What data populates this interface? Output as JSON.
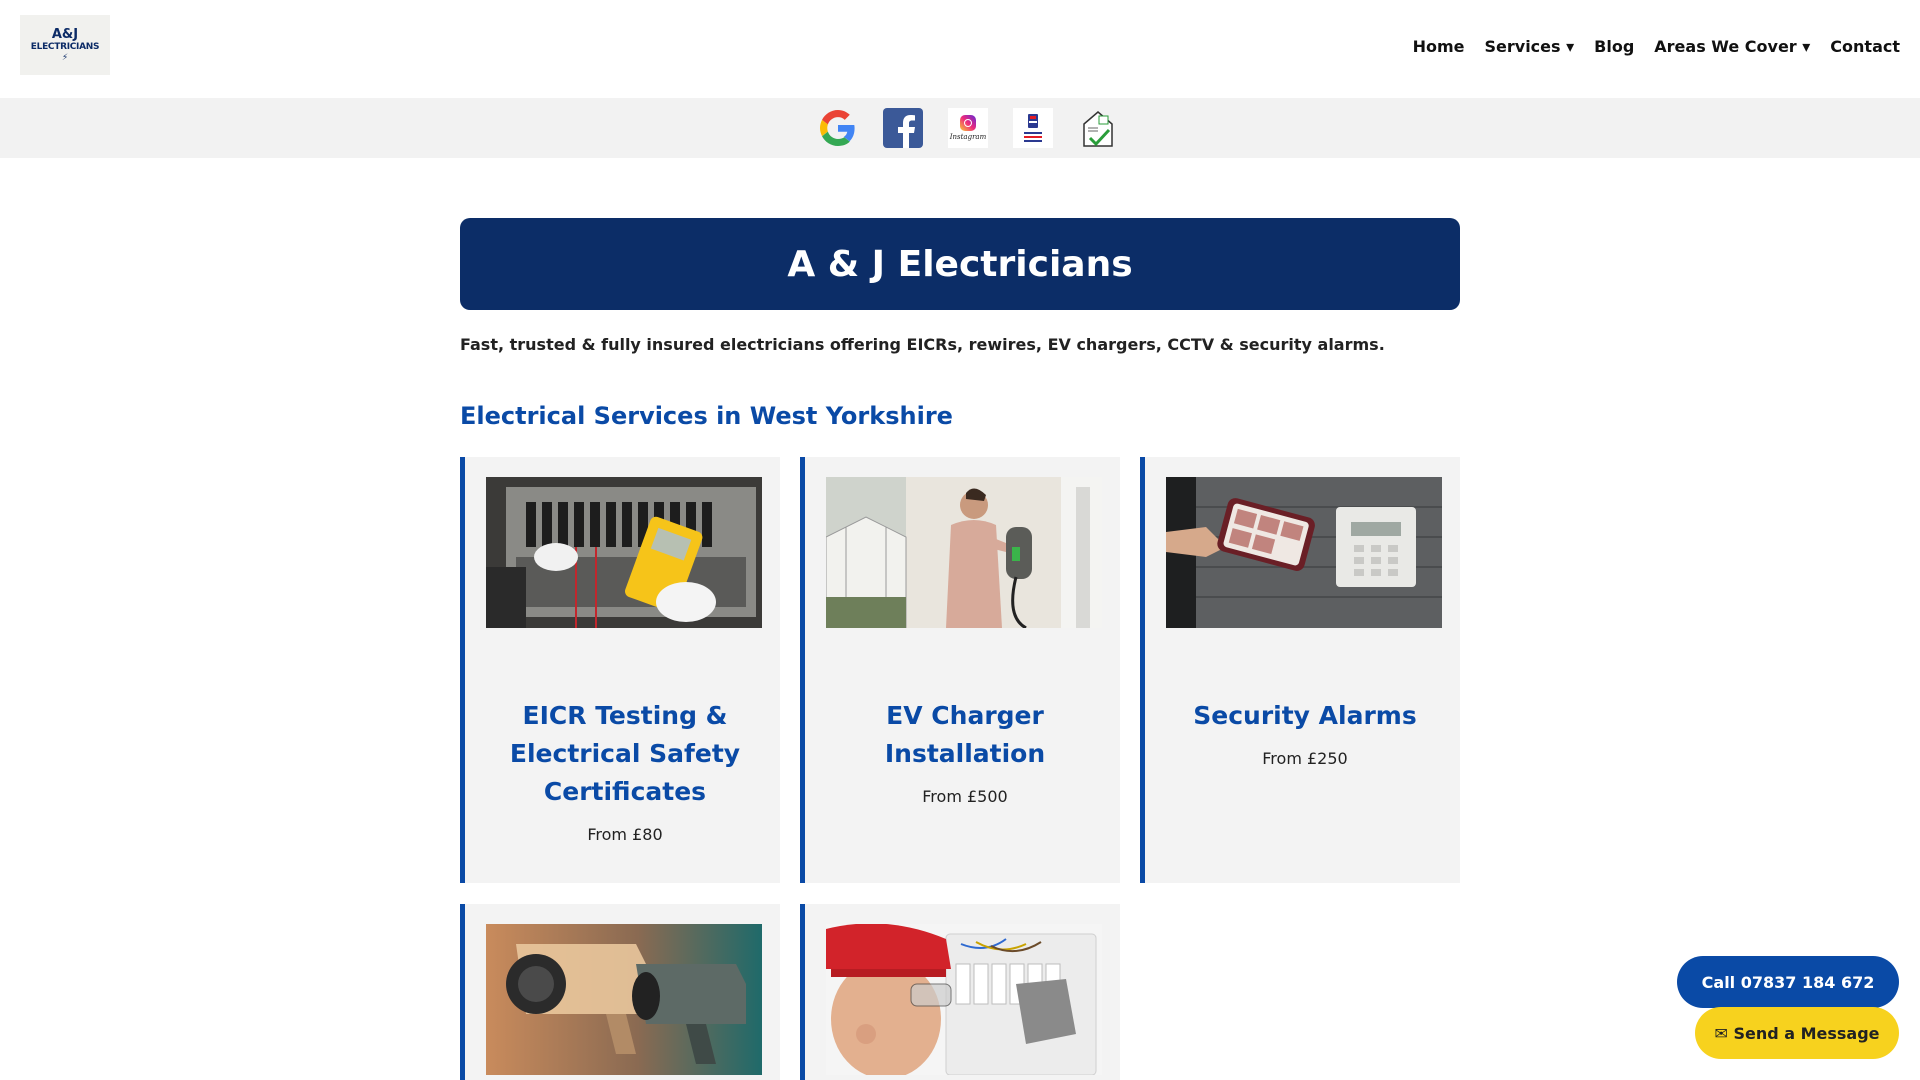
{
  "header": {
    "logo": {
      "line1": "A&J",
      "line2": "ELECTRICIANS"
    },
    "nav": [
      {
        "label": "Home"
      },
      {
        "label": "Services ▾"
      },
      {
        "label": "Blog"
      },
      {
        "label": "Areas We Cover ▾"
      },
      {
        "label": "Contact"
      }
    ]
  },
  "social_icons": [
    "google-icon",
    "facebook-icon",
    "instagram-icon",
    "napit-badge-icon",
    "trustmark-icon"
  ],
  "social_text": {
    "instagram": "Instagram"
  },
  "main": {
    "title": "A & J Electricians",
    "intro": "Fast, trusted & fully insured electricians offering EICRs, rewires, EV chargers, CCTV & security alarms.",
    "section_title": "Electrical Services in West Yorkshire",
    "services": [
      {
        "title": "EICR Testing & Electrical Safety Certificates",
        "price": "From £80",
        "image": "electrician-testing-panel-photo"
      },
      {
        "title": "EV Charger Installation",
        "price": "From £500",
        "image": "ev-charger-photo"
      },
      {
        "title": "Security Alarms",
        "price": "From £250",
        "image": "security-alarm-photo"
      },
      {
        "title": "",
        "price": "",
        "image": "cctv-camera-photo"
      },
      {
        "title": "",
        "price": "",
        "image": "consumer-unit-photo"
      }
    ]
  },
  "floating": {
    "call_label": " Call 07837 184 672",
    "message_label": "✉ Send a Message"
  },
  "colors": {
    "brand_navy": "#0c2d67",
    "brand_blue": "#0a4aa6",
    "accent_yellow": "#f7d21e",
    "strip_grey": "#f2f2f2",
    "card_grey": "#f3f3f3"
  }
}
